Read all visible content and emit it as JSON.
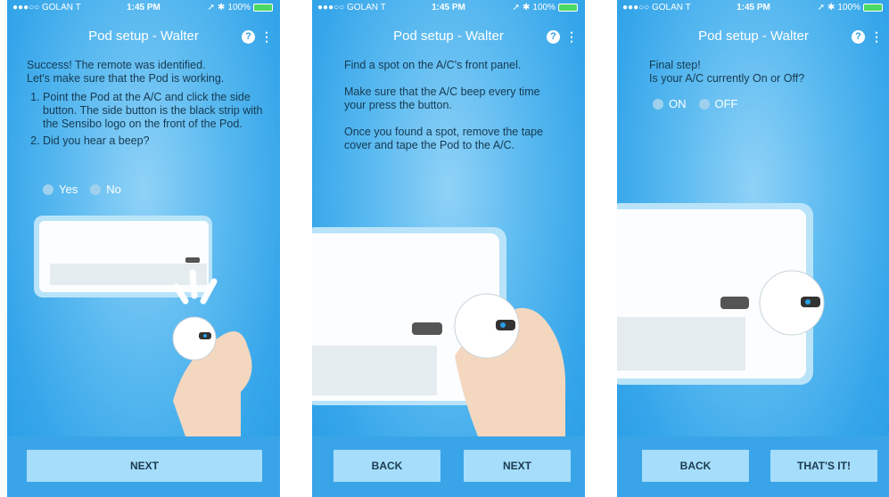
{
  "status": {
    "carrier": "●●●○○ GOLAN T",
    "wifi_icon": "wifi-icon",
    "time": "1:45 PM",
    "battery": "100%"
  },
  "screens": [
    {
      "title": "Pod setup - Walter",
      "help": "?",
      "menu": "⋮",
      "intro": [
        "Success! The remote was identified.",
        "Let's make sure that the Pod is working."
      ],
      "steps": [
        "Point the Pod at the A/C and click the side button. The side button is the black strip with the Sensibo logo on the front of the Pod.",
        "Did you hear a beep?"
      ],
      "options": [
        "Yes",
        "No"
      ],
      "buttons": [
        "NEXT"
      ]
    },
    {
      "title": "Pod setup - Walter",
      "help": "?",
      "menu": "⋮",
      "paragraphs": [
        "Find a spot on the A/C's front panel.",
        "Make sure that the A/C beep every time your press the button.",
        "Once you found a spot, remove the tape cover and tape the Pod to the A/C."
      ],
      "buttons": [
        "BACK",
        "NEXT"
      ]
    },
    {
      "title": "Pod setup - Walter",
      "help": "?",
      "menu": "⋮",
      "paragraphs": [
        "Final step!",
        "Is your A/C currently On or Off?"
      ],
      "options": [
        "ON",
        "OFF"
      ],
      "buttons": [
        "BACK",
        "THAT'S IT!"
      ]
    }
  ]
}
